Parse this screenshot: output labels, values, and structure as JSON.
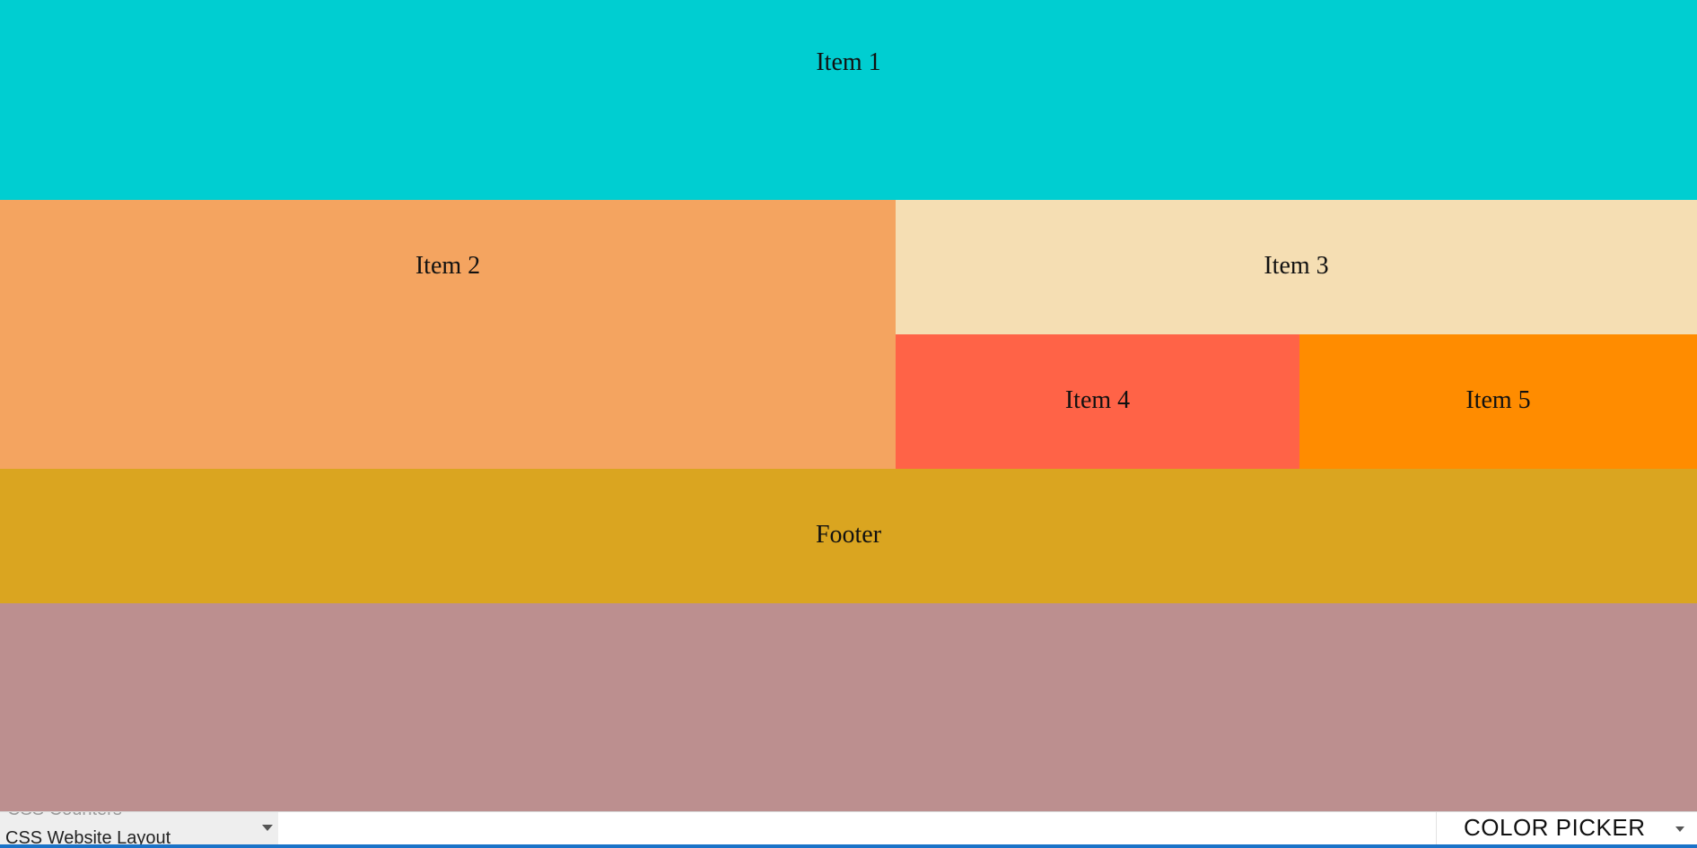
{
  "layout_demo": {
    "item1": {
      "label": "Item 1",
      "color": "#00CED1"
    },
    "item2": {
      "label": "Item 2",
      "color": "#F4A460"
    },
    "item3": {
      "label": "Item 3",
      "color": "#F5DEB3"
    },
    "item4": {
      "label": "Item 4",
      "color": "#FF6347"
    },
    "item5": {
      "label": "Item 5",
      "color": "#FF8C00"
    },
    "footer": {
      "label": "Footer",
      "color": "#DAA520"
    },
    "filler": {
      "color": "#BC8F8F"
    }
  },
  "bottom_panel": {
    "select": {
      "ghost_option": "CSS Counters",
      "selected_value": "CSS Website Layout"
    },
    "color_picker": {
      "label": "COLOR PICKER"
    },
    "accent_color": "#1A73C8"
  }
}
